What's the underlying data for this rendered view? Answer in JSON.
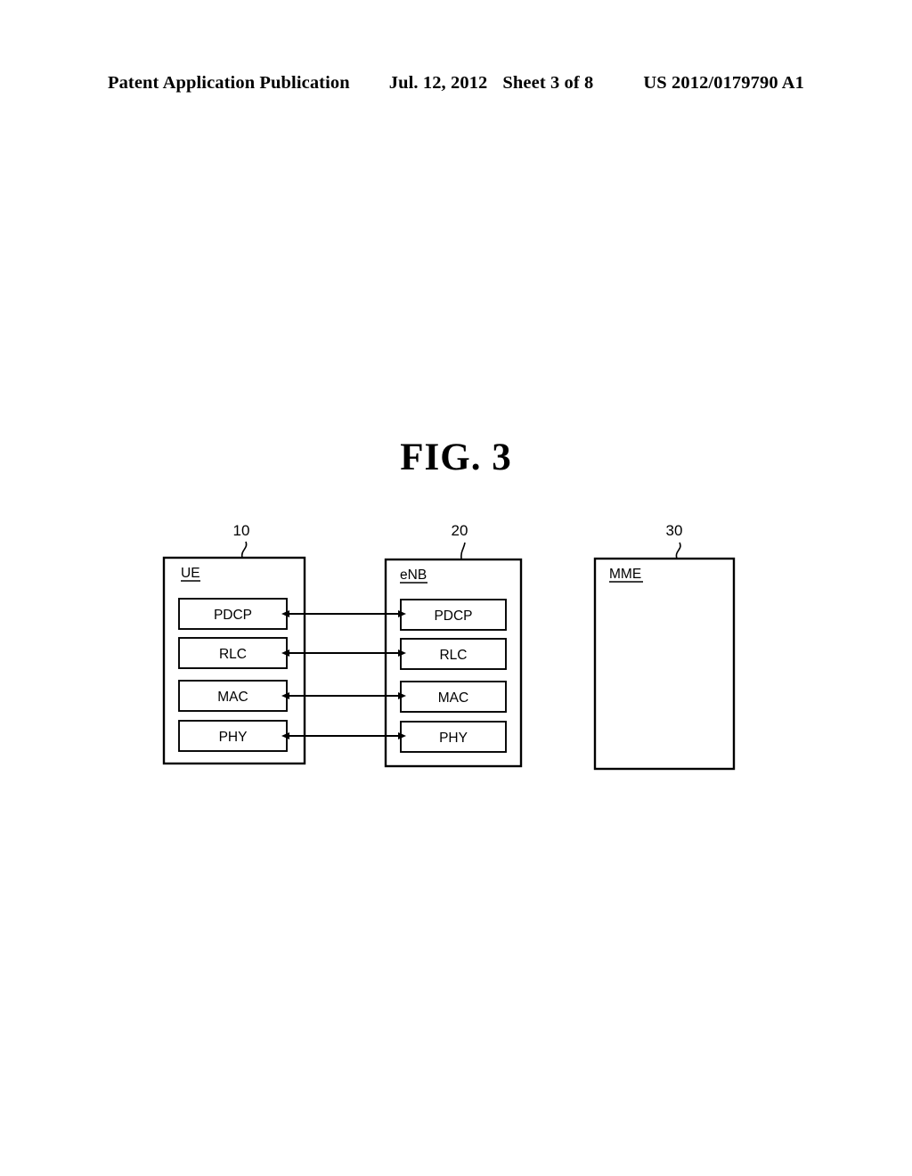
{
  "header": {
    "publication": "Patent Application Publication",
    "date": "Jul. 12, 2012",
    "sheet": "Sheet 3 of 8",
    "patent_number": "US 2012/0179790 A1"
  },
  "figure": {
    "title": "FIG. 3",
    "nodes": [
      {
        "id": "ue",
        "label": "UE",
        "ref": "10",
        "layers": [
          "PDCP",
          "RLC",
          "MAC",
          "PHY"
        ]
      },
      {
        "id": "enb",
        "label": "eNB",
        "ref": "20",
        "layers": [
          "PDCP",
          "RLC",
          "MAC",
          "PHY"
        ]
      },
      {
        "id": "mme",
        "label": "MME",
        "ref": "30",
        "layers": []
      }
    ],
    "connections": [
      {
        "from": "ue.PDCP",
        "to": "enb.PDCP",
        "style": "double-arrow"
      },
      {
        "from": "ue.RLC",
        "to": "enb.RLC",
        "style": "double-arrow"
      },
      {
        "from": "ue.MAC",
        "to": "enb.MAC",
        "style": "double-arrow"
      },
      {
        "from": "ue.PHY",
        "to": "enb.PHY",
        "style": "double-arrow"
      }
    ],
    "line_color": "#000000",
    "background": "#ffffff"
  }
}
